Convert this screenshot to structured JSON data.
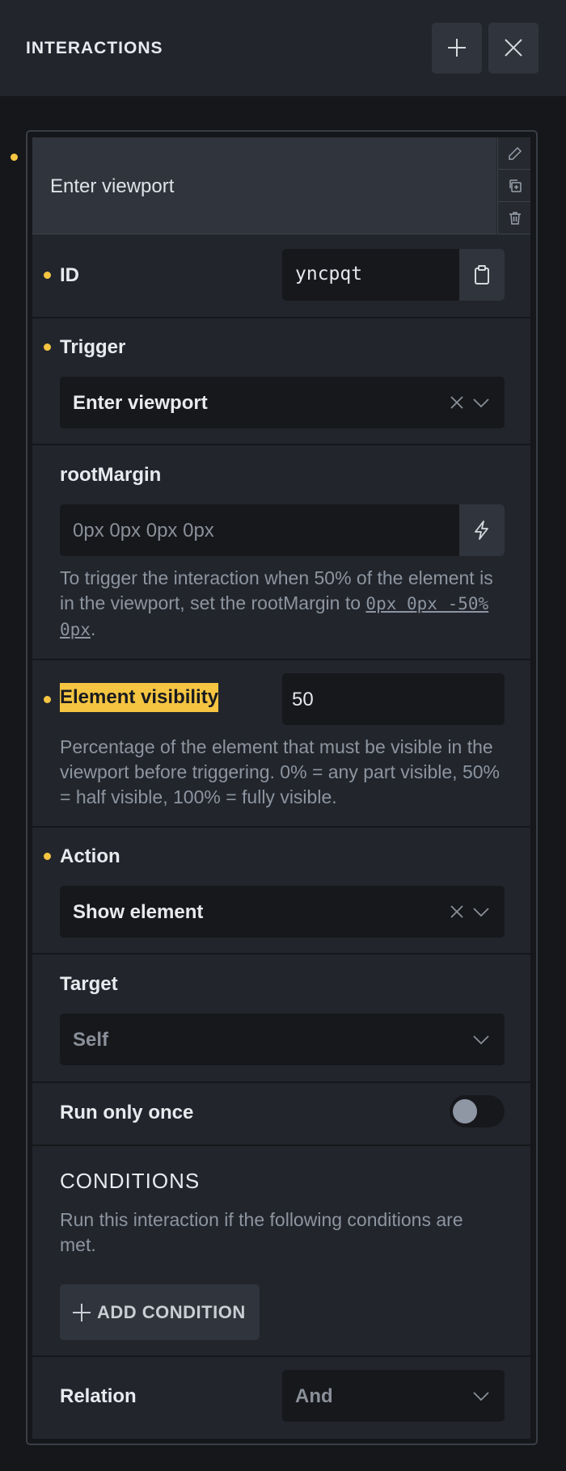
{
  "header": {
    "title": "INTERACTIONS",
    "add_icon": "plus-icon",
    "close_icon": "close-icon"
  },
  "interaction": {
    "title": "Enter viewport",
    "side_actions": [
      "pencil-icon",
      "duplicate-icon",
      "trash-icon"
    ],
    "id": {
      "label": "ID",
      "value": "yncpqt",
      "copy_icon": "clipboard-icon"
    },
    "trigger": {
      "label": "Trigger",
      "value": "Enter viewport"
    },
    "root_margin": {
      "label": "rootMargin",
      "placeholder": "0px 0px 0px 0px",
      "help_prefix": "To trigger the interaction when 50% of the element is in the viewport, set the rootMargin to ",
      "help_code": "0px 0px -50% 0px",
      "help_suffix": "."
    },
    "element_visibility": {
      "label": "Element visibility",
      "value": "50",
      "help": "Percentage of the element that must be visible in the viewport before triggering. 0% = any part visible, 50% = half visible, 100% = fully visible."
    },
    "action": {
      "label": "Action",
      "value": "Show element"
    },
    "target": {
      "label": "Target",
      "value": "Self"
    },
    "run_only_once": {
      "label": "Run only once",
      "enabled": false
    },
    "conditions": {
      "title": "CONDITIONS",
      "help": "Run this interaction if the following conditions are met.",
      "add_label": "ADD CONDITION"
    },
    "relation": {
      "label": "Relation",
      "value": "And"
    }
  },
  "colors": {
    "accent": "#f5c542",
    "panel": "#22252c",
    "field": "#17181c",
    "button": "#30343c"
  }
}
